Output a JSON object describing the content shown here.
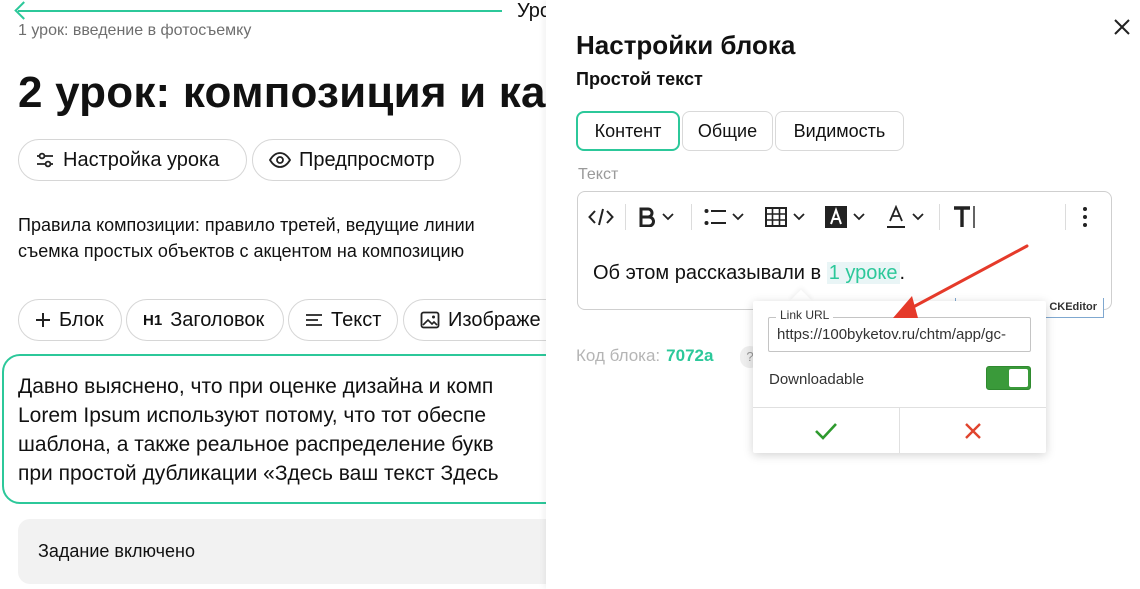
{
  "left": {
    "next_label": "Уро",
    "prev_lesson": "1 урок: введение в фотосъемку",
    "title": "2 урок: композиция и ка",
    "buttons": {
      "settings": "Настройка урока",
      "preview": "Предпросмотр"
    },
    "description": [
      "Правила композиции: правило третей, ведущие линии",
      "съемка простых объектов с акцентом на композицию"
    ],
    "add_block": {
      "block": "Блок",
      "heading_badge": "H1",
      "heading": "Заголовок",
      "text": "Текст",
      "image": "Изображе"
    },
    "content_lines": [
      "Давно выяснено, что при оценке дизайна и комп",
      "Lorem Ipsum используют потому, что тот обеспе",
      "шаблона, а также реальное распределение букв",
      "при простой дубликации «Здесь ваш текст Здесь"
    ],
    "task": "Задание включено"
  },
  "panel": {
    "title": "Настройки блока",
    "subtitle": "Простой текст",
    "tabs": [
      {
        "label": "Контент",
        "active": true
      },
      {
        "label": "Общие",
        "active": false
      },
      {
        "label": "Видимость",
        "active": false
      }
    ],
    "field_label": "Текст",
    "editor": {
      "text_before": "Об этом рассказывали в ",
      "link_text": "1 уроке",
      "text_after": ".",
      "badge": "CKEditor"
    },
    "code_label": "Код блока:",
    "code_value": "7072a",
    "help": "?"
  },
  "link_popup": {
    "url_label": "Link URL",
    "url_value": "https://100byketov.ru/chtm/app/gc-",
    "downloadable_label": "Downloadable",
    "downloadable": true
  },
  "colors": {
    "accent": "#2cc89a",
    "switch_on": "#3a9a3a",
    "confirm": "#2e9a2e",
    "cancel": "#e0442e",
    "annotation": "#e53a2a"
  }
}
